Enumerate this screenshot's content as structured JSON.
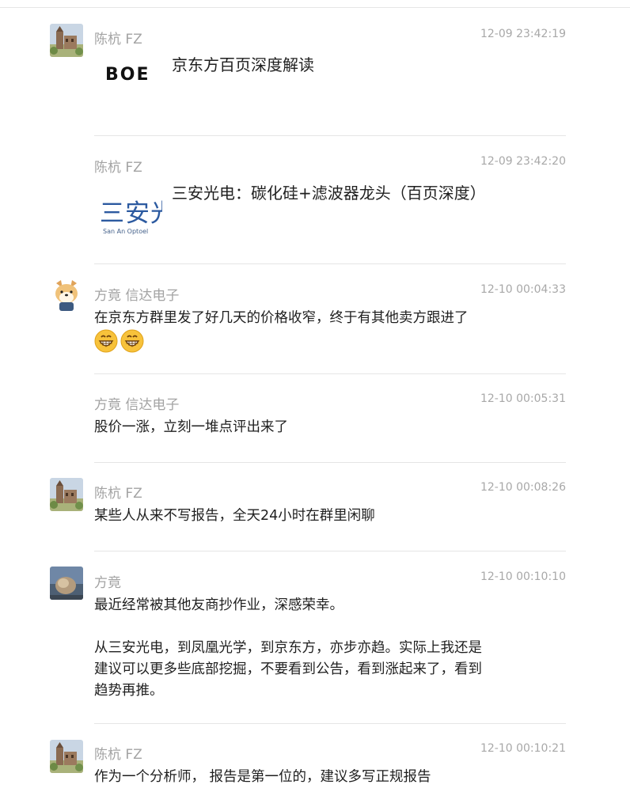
{
  "messages": [
    {
      "sender": "陈杭 FZ",
      "time": "12-09 23:42:19",
      "card_title": "京东方百页深度解读",
      "card_logo_text": "BOE"
    },
    {
      "sender": "陈杭 FZ",
      "time": "12-09 23:42:20",
      "card_title": "三安光电：碳化硅+滤波器龙头（百页深度）",
      "card_logo_text": "三安光",
      "card_logo_subtext": "San An Optoel"
    },
    {
      "sender": "方竟 信达电子",
      "time": "12-10 00:04:33",
      "text": "在京东方群里发了好几天的价格收窄，终于有其他卖方跟进了",
      "emoji": [
        "grinning-face-emoji",
        "grinning-face-emoji"
      ]
    },
    {
      "sender": "方竟 信达电子",
      "time": "12-10 00:05:31",
      "text": "股价一涨，立刻一堆点评出来了"
    },
    {
      "sender": "陈杭 FZ",
      "time": "12-10 00:08:26",
      "text": "某些人从来不写报告，全天24小时在群里闲聊"
    },
    {
      "sender": "方竟",
      "time": "12-10 00:10:10",
      "text": "最近经常被其他友商抄作业，深感荣幸。\n\n从三安光电，到凤凰光学，到京东方，亦步亦趋。实际上我还是\n建议可以更多些底部挖掘，不要看到公告，看到涨起来了，看到\n趋势再推。"
    },
    {
      "sender": "陈杭 FZ",
      "time": "12-10 00:10:21",
      "text": "作为一个分析师， 报告是第一位的，建议多写正规报告"
    }
  ],
  "colors": {
    "meta": "#a3a3a3",
    "text": "#1f1f1f",
    "separator": "#e5e5e5",
    "sanan_blue": "#2c5aa0"
  }
}
